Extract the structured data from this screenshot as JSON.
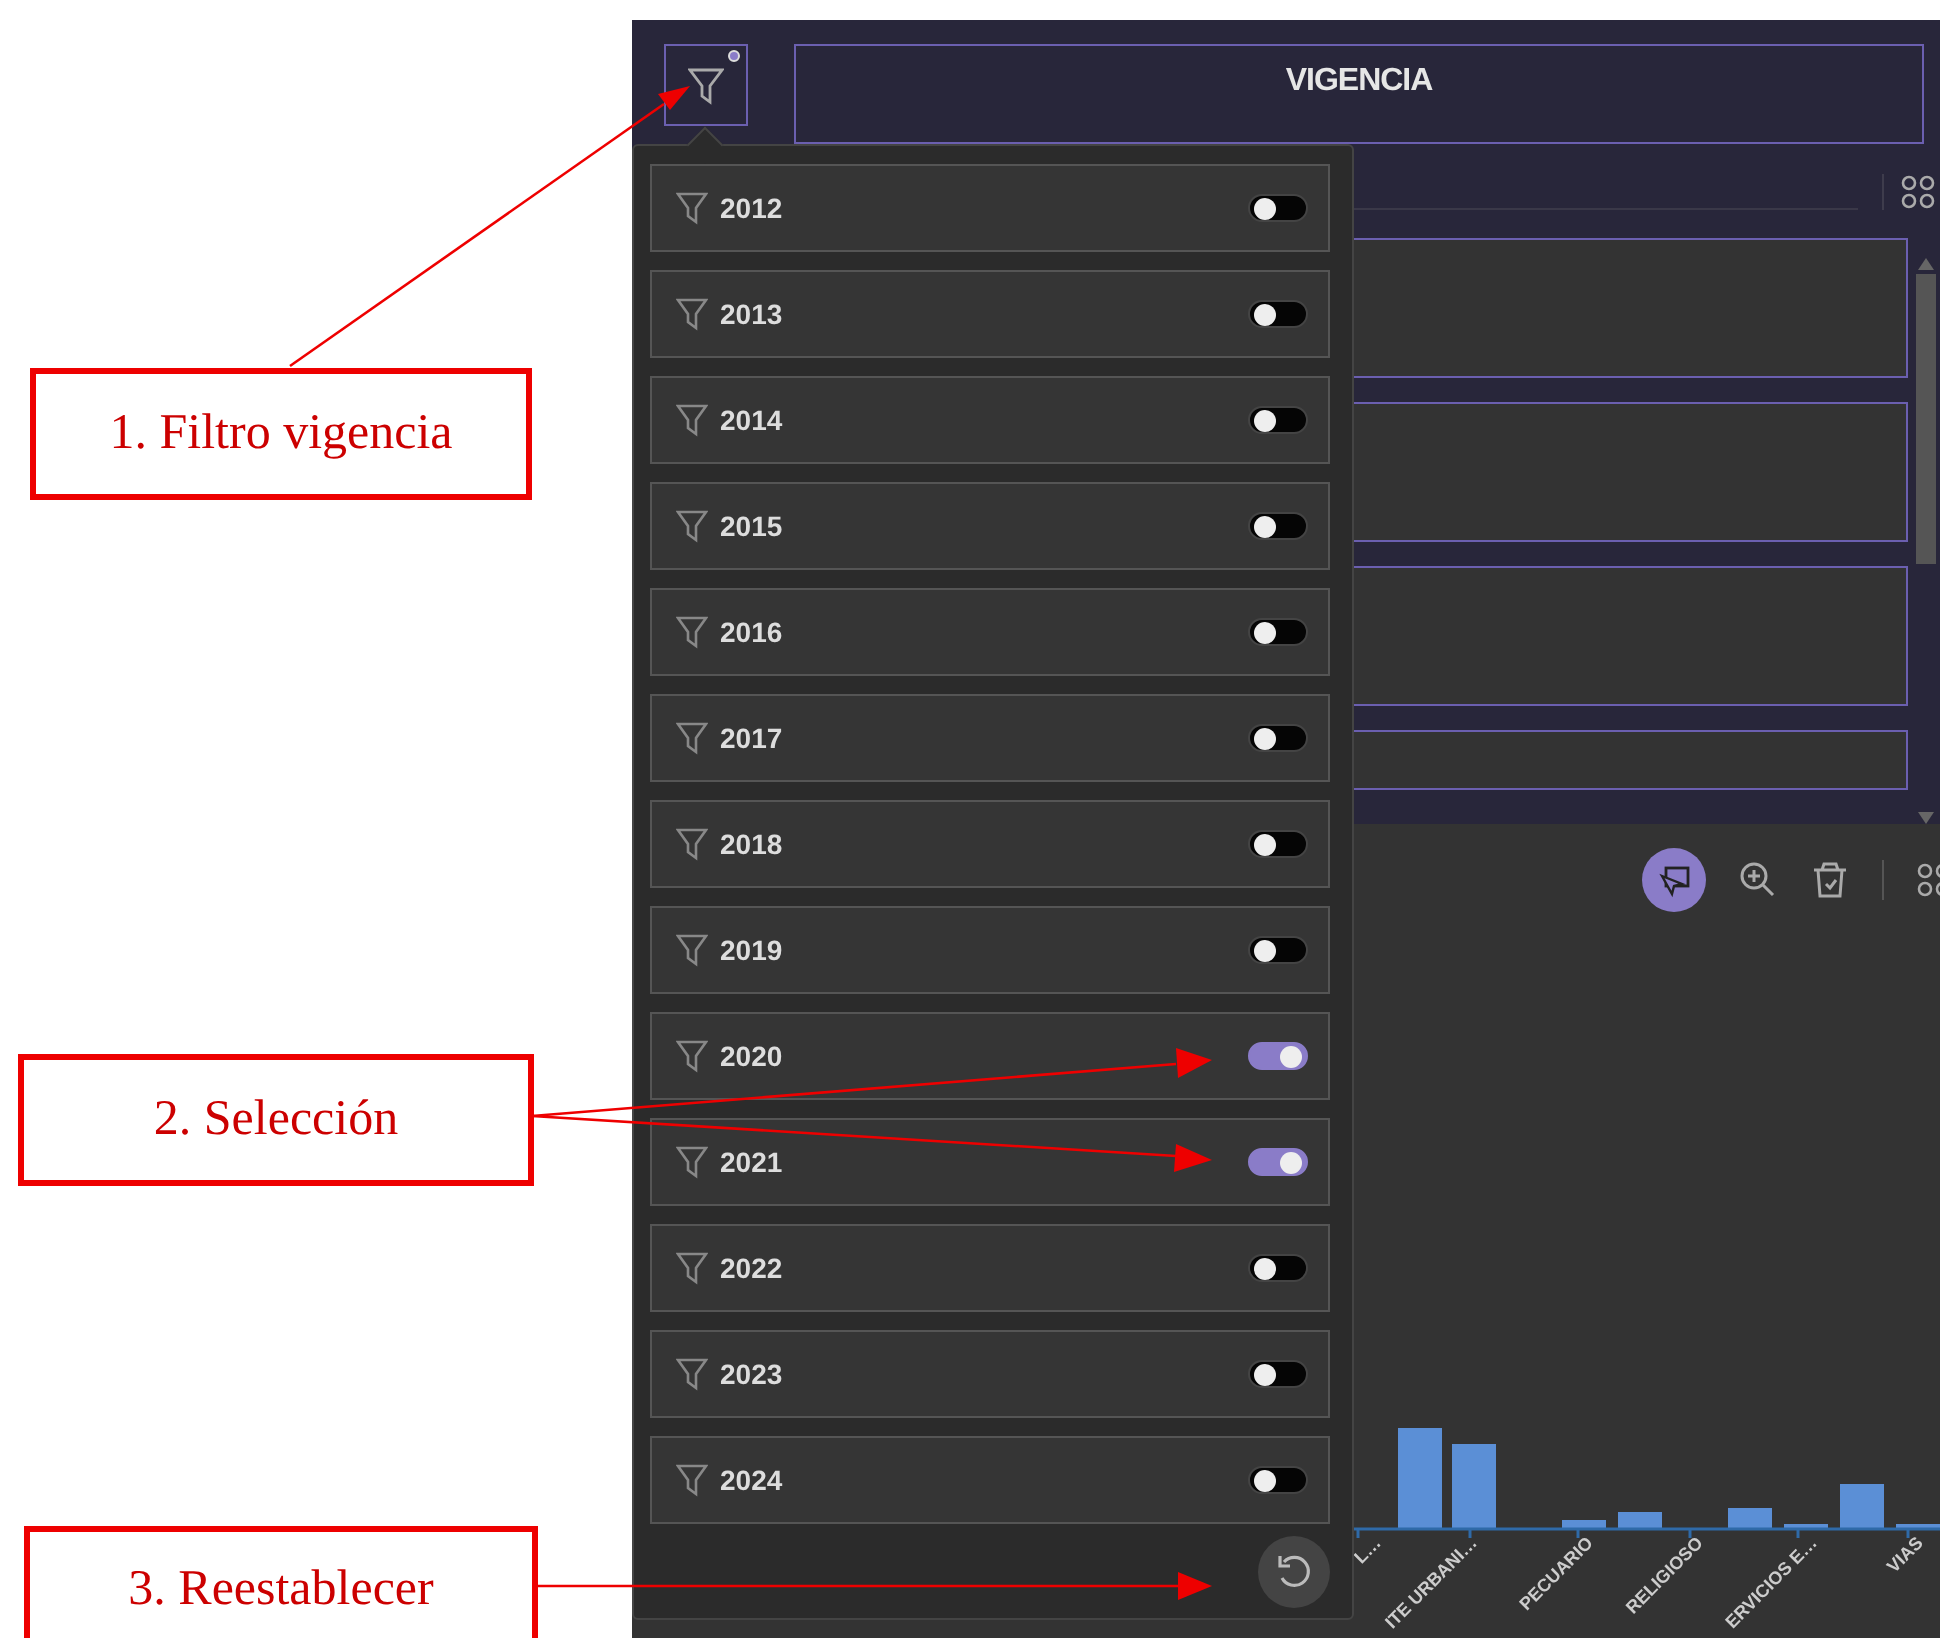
{
  "header": {
    "title": "VIGENCIA"
  },
  "year_filter": {
    "items": [
      {
        "label": "2012",
        "on": false
      },
      {
        "label": "2013",
        "on": false
      },
      {
        "label": "2014",
        "on": false
      },
      {
        "label": "2015",
        "on": false
      },
      {
        "label": "2016",
        "on": false
      },
      {
        "label": "2017",
        "on": false
      },
      {
        "label": "2018",
        "on": false
      },
      {
        "label": "2019",
        "on": false
      },
      {
        "label": "2020",
        "on": true
      },
      {
        "label": "2021",
        "on": true
      },
      {
        "label": "2022",
        "on": false
      },
      {
        "label": "2023",
        "on": false
      },
      {
        "label": "2024",
        "on": false
      }
    ]
  },
  "chart": {
    "x_labels": [
      "L…",
      "ITE URBANI…",
      "PECUARIO",
      "RELIGIOSO",
      "ERVICIOS E…",
      "VIAS"
    ]
  },
  "annotations": [
    {
      "label": "1. Filtro vigencia"
    },
    {
      "label": "2. Selección"
    },
    {
      "label": "3. Reestablecer"
    }
  ]
}
